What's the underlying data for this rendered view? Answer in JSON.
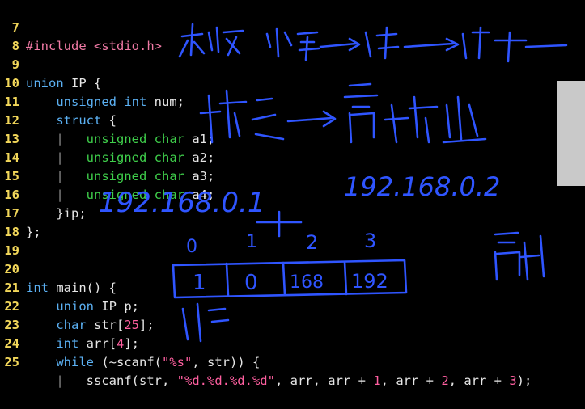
{
  "code": {
    "line_numbers": [
      "7",
      "8",
      "9",
      "10",
      "11",
      "12",
      "13",
      "14",
      "15",
      "16",
      "17",
      "18",
      "19",
      "20",
      "21",
      "22",
      "23",
      "24",
      "25"
    ],
    "l7_pp": "#include",
    "l7_hdr": "<stdio.h>",
    "l9_kw": "union",
    "l9_rest": " IP {",
    "l10_ty": "unsigned int",
    "l10_rest": " num;",
    "l11_kw": "struct",
    "l11_rest": " {",
    "bar": "|",
    "char_ty": "unsigned char",
    "l12_rest": " a1;",
    "l13_rest": " a2;",
    "l14_rest": " a3;",
    "l15_rest": " a4;",
    "l16": "}ip;",
    "l17": "};",
    "l20_ty": "int",
    "l20_rest": " main() {",
    "l21_kw": "union",
    "l21_rest": " IP p;",
    "l22_ty": "char",
    "l22_rest1": " str[",
    "l22_num": "25",
    "l22_rest2": "];",
    "l23_ty": "int",
    "l23_rest1": " arr[",
    "l23_num": "4",
    "l23_rest2": "];",
    "l24_kw": "while",
    "l24_rest1": " (~scanf(",
    "l24_str": "\"%s\"",
    "l24_rest2": ", str)) {",
    "l25_a": "sscanf(str, ",
    "l25_str": "\"%d.%d.%d.%d\"",
    "l25_b": ", arr, arr + ",
    "l25_n1": "1",
    "l25_c": ", arr + ",
    "l25_n2": "2",
    "l25_d": ", arr + ",
    "l25_n3": "3",
    "l25_e": ");"
  },
  "annotations": {
    "ip1": "192.168.0.1",
    "ip2": "192.168.0.2",
    "idx0": "0",
    "idx1": "1",
    "idx2": "2",
    "idx3": "3",
    "cell0": "1",
    "cell1": "0",
    "cell2": "168",
    "cell3": "192"
  },
  "colors": {
    "background": "#000000",
    "line_number": "#f2d75a",
    "keyword": "#5bb0f2",
    "member_type": "#3fcf4b",
    "preprocessor": "#f07aa5",
    "string": "#ff5fa0",
    "ink": "#2f55ff"
  }
}
